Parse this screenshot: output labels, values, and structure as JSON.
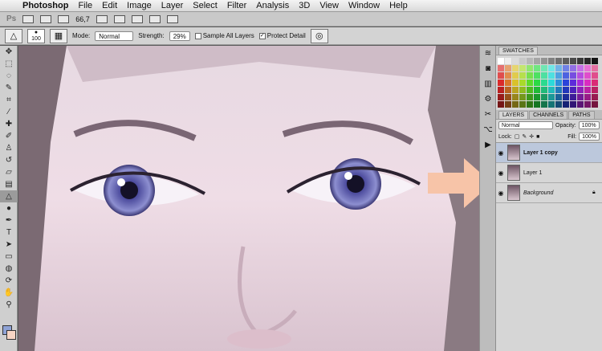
{
  "menubar": {
    "apple_glyph": "",
    "items": [
      "Photoshop",
      "File",
      "Edit",
      "Image",
      "Layer",
      "Select",
      "Filter",
      "Analysis",
      "3D",
      "View",
      "Window",
      "Help"
    ]
  },
  "appbar": {
    "logo": "Ps",
    "zoom": "66,7"
  },
  "options": {
    "brush_size": "100",
    "mode_label": "Mode:",
    "mode_value": "Normal",
    "strength_label": "Strength:",
    "strength_value": "29%",
    "sample_all_layers": "Sample All Layers",
    "sample_all_checked": false,
    "protect_detail": "Protect Detail",
    "protect_detail_checked": true
  },
  "colors": {
    "foreground": "#8fa3d6",
    "background": "#f7d5c4",
    "arrow": "#f7c4a8"
  },
  "panels": {
    "swatches_tab": "SWATCHES",
    "layer_tabs": [
      "LAYERS",
      "CHANNELS",
      "PATHS"
    ],
    "blend_mode": "Normal",
    "opacity_label": "Opacity:",
    "opacity_value": "100%",
    "lock_label": "Lock:",
    "fill_label": "Fill:",
    "fill_value": "100%",
    "layers": [
      {
        "name": "Layer 1 copy",
        "selected": true,
        "style": "bold",
        "locked": false
      },
      {
        "name": "Layer 1",
        "selected": false,
        "style": "normal",
        "locked": false
      },
      {
        "name": "Background",
        "selected": false,
        "style": "italic",
        "locked": true
      }
    ]
  }
}
